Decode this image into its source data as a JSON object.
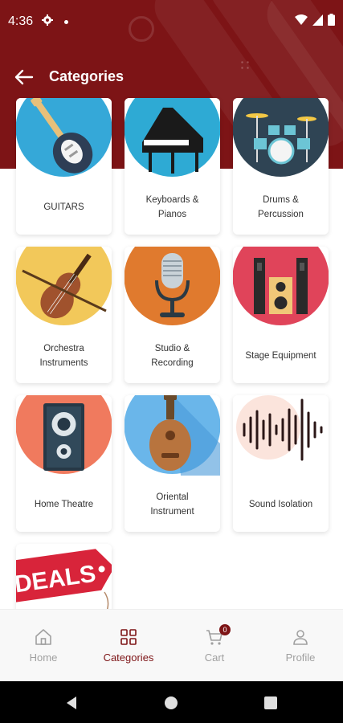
{
  "status_bar": {
    "time": "4:36"
  },
  "app_bar": {
    "title": "Categories"
  },
  "categories": [
    {
      "label": "GUITARS"
    },
    {
      "label": "Keyboards &\nPianos"
    },
    {
      "label": "Drums &\nPercussion"
    },
    {
      "label": "Orchestra\nInstruments"
    },
    {
      "label": "Studio &\nRecording"
    },
    {
      "label": "Stage Equipment"
    },
    {
      "label": "Home Theatre"
    },
    {
      "label": "Oriental\nInstrument"
    },
    {
      "label": "Sound Isolation"
    },
    {
      "label": ""
    }
  ],
  "deals_image_text": "DEALS",
  "bottom_nav": {
    "items": [
      {
        "label": "Home"
      },
      {
        "label": "Categories"
      },
      {
        "label": "Cart",
        "badge": "0"
      },
      {
        "label": "Profile"
      }
    ],
    "active": "Categories"
  },
  "colors": {
    "primary": "#7d1416",
    "nav_inactive": "#a0a0a0"
  }
}
